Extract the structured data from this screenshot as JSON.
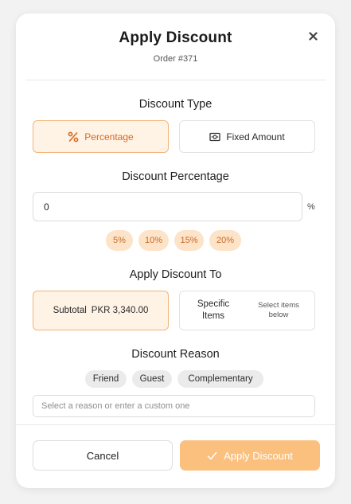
{
  "modal": {
    "title": "Apply Discount",
    "subtitle": "Order #371",
    "close_icon": "close-icon"
  },
  "discount_type": {
    "heading": "Discount Type",
    "options": [
      {
        "label": "Percentage",
        "icon": "percent-icon",
        "selected": true
      },
      {
        "label": "Fixed Amount",
        "icon": "banknote-icon",
        "selected": false
      }
    ]
  },
  "discount_percentage": {
    "heading": "Discount Percentage",
    "value": "0",
    "suffix": "%",
    "presets": [
      "5%",
      "10%",
      "15%",
      "20%"
    ]
  },
  "apply_to": {
    "heading": "Apply Discount To",
    "subtotal_label": "Subtotal",
    "subtotal_amount": "PKR 3,340.00",
    "specific_label": "Specific Items",
    "specific_hint": "Select items below",
    "selected": "subtotal"
  },
  "reason": {
    "heading": "Discount Reason",
    "chips": [
      "Friend",
      "Guest",
      "Complementary"
    ],
    "placeholder": "Select a reason or enter a custom one",
    "value": ""
  },
  "footer": {
    "cancel_label": "Cancel",
    "apply_label": "Apply Discount",
    "apply_icon": "check-icon"
  },
  "colors": {
    "accent": "#f4a35c",
    "accent_soft": "#fff3e6",
    "chip_bg": "#fde3c8",
    "apply_button": "#fbc07e"
  }
}
